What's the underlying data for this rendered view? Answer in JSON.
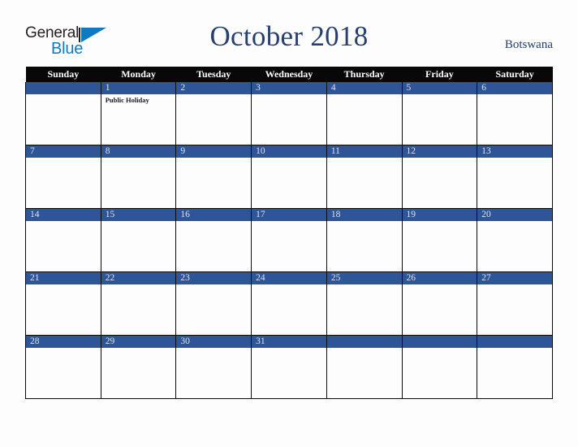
{
  "brand": {
    "word_one": "General",
    "word_two": "Blue",
    "triangle_icon": "triangle-icon",
    "color_dark": "#231f20",
    "color_blue": "#1079c0"
  },
  "header": {
    "title": "October 2018",
    "country": "Botswana",
    "title_color": "#27406d"
  },
  "calendar": {
    "weekday_headers": [
      "Sunday",
      "Monday",
      "Tuesday",
      "Wednesday",
      "Thursday",
      "Friday",
      "Saturday"
    ],
    "header_bg": "#080808",
    "daynum_bg": "#2e5597",
    "daynum_color": "#dde3ee",
    "weeks": [
      [
        {
          "day": "",
          "events": []
        },
        {
          "day": "1",
          "events": [
            "Public Holiday"
          ]
        },
        {
          "day": "2",
          "events": []
        },
        {
          "day": "3",
          "events": []
        },
        {
          "day": "4",
          "events": []
        },
        {
          "day": "5",
          "events": []
        },
        {
          "day": "6",
          "events": []
        }
      ],
      [
        {
          "day": "7",
          "events": []
        },
        {
          "day": "8",
          "events": []
        },
        {
          "day": "9",
          "events": []
        },
        {
          "day": "10",
          "events": []
        },
        {
          "day": "11",
          "events": []
        },
        {
          "day": "12",
          "events": []
        },
        {
          "day": "13",
          "events": []
        }
      ],
      [
        {
          "day": "14",
          "events": []
        },
        {
          "day": "15",
          "events": []
        },
        {
          "day": "16",
          "events": []
        },
        {
          "day": "17",
          "events": []
        },
        {
          "day": "18",
          "events": []
        },
        {
          "day": "19",
          "events": []
        },
        {
          "day": "20",
          "events": []
        }
      ],
      [
        {
          "day": "21",
          "events": []
        },
        {
          "day": "22",
          "events": []
        },
        {
          "day": "23",
          "events": []
        },
        {
          "day": "24",
          "events": []
        },
        {
          "day": "25",
          "events": []
        },
        {
          "day": "26",
          "events": []
        },
        {
          "day": "27",
          "events": []
        }
      ],
      [
        {
          "day": "28",
          "events": []
        },
        {
          "day": "29",
          "events": []
        },
        {
          "day": "30",
          "events": []
        },
        {
          "day": "31",
          "events": []
        },
        {
          "day": "",
          "events": []
        },
        {
          "day": "",
          "events": []
        },
        {
          "day": "",
          "events": []
        }
      ]
    ]
  }
}
